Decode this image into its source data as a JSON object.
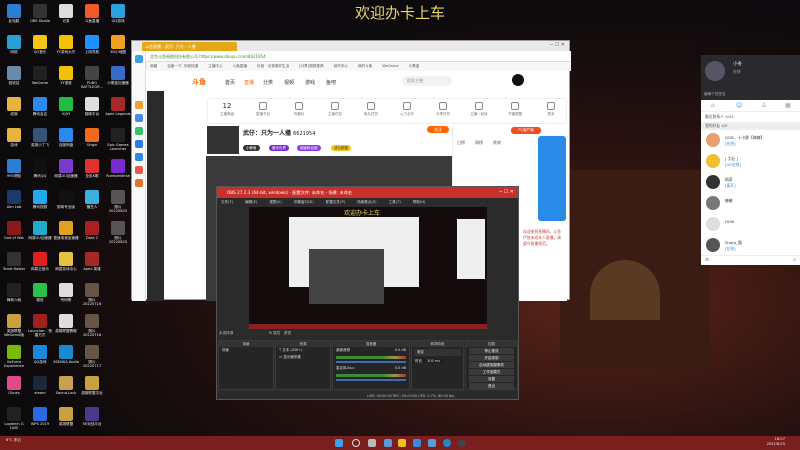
{
  "desktop": {
    "banner": "欢迎办卡上车",
    "icons": [
      [
        "此电脑",
        "#2a7fd4"
      ],
      [
        "OBS Studio",
        "#333"
      ],
      [
        "记录",
        "#ddd"
      ],
      [
        "斗鱼直播",
        "#f05a28"
      ],
      [
        "QQ游戏",
        "#29a3e0"
      ],
      [
        "网络",
        "#2a9fd4"
      ],
      [
        "QQ音乐",
        "#f5c518"
      ],
      [
        "YY游戏大厅",
        "#f2c200"
      ],
      [
        "上网导航",
        "#1e90ff"
      ],
      [
        "3D小地图",
        "#f0a020"
      ],
      [
        "回收站",
        "#6a8aa8"
      ],
      [
        "WeGame",
        "#222"
      ],
      [
        "YY语音",
        "#f2c200"
      ],
      [
        "PUBG BATTLEGR...",
        "#444"
      ],
      [
        "小黑盒加速器",
        "#3a6ac8"
      ],
      [
        "成就",
        "#e8b440"
      ],
      [
        "腾讯会议",
        "#2a8af0"
      ],
      [
        "iQIYI",
        "#22bb44"
      ],
      [
        "猫咪平台",
        "#ddd"
      ],
      [
        "Apex Legends",
        "#a82828"
      ],
      [
        "游戏",
        "#e8b440"
      ],
      [
        "英雄小丁飞",
        "#335577"
      ],
      [
        "百度网盘",
        "#2a88ee"
      ],
      [
        "Origin",
        "#f06a1a"
      ],
      [
        "Epic Games Launcher",
        "#222"
      ],
      [
        "990测验",
        "#2a7fd4"
      ],
      [
        "腾讯QQ",
        "#111"
      ],
      [
        "网易UU加速器",
        "#7a3ad0"
      ],
      [
        "全民K歌",
        "#e03030"
      ],
      [
        "RumbleVerse",
        "#7a2ad0"
      ],
      [
        "Aim Lab",
        "#1a3a6a"
      ],
      [
        "腾讯视频",
        "#22aaee"
      ],
      [
        "剪映专业版",
        "#111"
      ],
      [
        "糖豆人",
        "#3ab0e0"
      ],
      [
        "照片 20220825",
        "#555"
      ],
      [
        "God of War",
        "#8a1a1a"
      ],
      [
        "网易UU加速器",
        "#22aacc"
      ],
      [
        "极速电竞加速器",
        "#e0a020"
      ],
      [
        "Dota 2",
        "#a82020"
      ],
      [
        "照片 20220825",
        "#555"
      ],
      [
        "Tomb Raider",
        "#333"
      ],
      [
        "网易云音乐",
        "#e02020"
      ],
      [
        "网易游戏中心",
        "#e8c040"
      ],
      [
        "Apex 英雄",
        "#a82828"
      ],
      [
        "梅林六耗",
        "#222"
      ],
      [
        "微信",
        "#2ac04a"
      ],
      [
        "号码等",
        "#ddd"
      ],
      [
        "照片 20220716",
        "#665544"
      ],
      [
        "英雄联盟WeGame版",
        "#c8a040"
      ],
      [
        "Launcher - 快捷方式",
        "#a02020"
      ],
      [
        "英雄联盟教程",
        "#ddd"
      ],
      [
        "照片 20220716",
        "#665544"
      ],
      [
        "GeForce Experience",
        "#76b900"
      ],
      [
        "QQ游戏",
        "#1a8ae0"
      ],
      [
        "XSENSA Audio",
        "#1a8ad0"
      ],
      [
        "照片 20220717",
        "#665544"
      ],
      [
        "iTunes",
        "#e04a8a"
      ],
      [
        "steam",
        "#1b2838"
      ],
      [
        "Sound Lock",
        "#c8a050"
      ],
      [
        "英雄联盟平台",
        "#c8a040"
      ],
      [
        "Logitech G HUB",
        "#222"
      ],
      [
        "WPS 2019",
        "#2a6ae0"
      ],
      [
        "英雄联盟",
        "#c8a040"
      ],
      [
        "5E对战平台",
        "#4a3a8a"
      ]
    ]
  },
  "browser": {
    "tab": "斗鱼直播 - 武仔: 只为一人播",
    "address": "北京斗鱼网络科技有限公司 https://www.douyu.com/6621954",
    "bookmarks": [
      "收藏",
      "百度一下, 你就知道",
      "主播中心",
      "斗鱼直播",
      "抖音 · 记录美好生活",
      "[分享]视频推荐",
      "创作中心",
      "我的斗鱼",
      "WeGame",
      "小黑盒"
    ],
    "nav": [
      "首页",
      "直播",
      "分类",
      "视频",
      "游戏",
      "鱼吧"
    ],
    "logo": "斗鱼",
    "search_placeholder": "搜索主播",
    "icons_row": [
      {
        "label": "主播等级",
        "value": "12"
      },
      {
        "label": "直播节目"
      },
      {
        "label": "有趣玩"
      },
      {
        "label": "主播任务"
      },
      {
        "label": "鱼丸任务"
      },
      {
        "label": "火力全开"
      },
      {
        "label": "分享任务"
      },
      {
        "label": "主播一起玩"
      },
      {
        "label": "开播提醒"
      },
      {
        "label": "更多"
      }
    ],
    "streamer_title": "武仔：只为一人播",
    "room_id": "6621954",
    "chips": [
      "小鲸鱼",
      "魔法世界",
      "超级粉丝团",
      "成为超管"
    ],
    "follow": "关注",
    "pc_client": "PC客户端",
    "right_tabs": [
      "日榜",
      "周榜",
      "贵宾"
    ],
    "right_notice": "欢迎来到直播间，斗鱼严禁未成年人直播，请遵守直播规范。"
  },
  "obs": {
    "title": "OBS 27.2.3 (64-bit, windows) - 配置文件: 未命名 - 场景: 未命名",
    "menu": [
      "文件(F)",
      "编辑(E)",
      "视图(V)",
      "停靠窗口(D)",
      "配置文件(P)",
      "场景集合(S)",
      "工具(T)",
      "帮助(H)"
    ],
    "docks": {
      "scenes": "场景",
      "sources": "来源",
      "mixer": "混音器",
      "transitions": "转场特效",
      "controls": "控制"
    },
    "scene_items": [
      "场景"
    ],
    "source_items": [
      "文本 (GDI+)",
      "显示器采集"
    ],
    "mixer": [
      {
        "name": "桌面音频",
        "db": "0.0 dB"
      },
      {
        "name": "麦克风/Aux",
        "db": "0.0 dB"
      }
    ],
    "transition": "渐变",
    "duration_label": "时长",
    "duration": "300 ms",
    "controls": [
      "停止推流",
      "开始录制",
      "启动虚拟摄像机",
      "工作室模式",
      "设置",
      "退出"
    ],
    "status": "LIVE: 00:00:00   REC: 00:00:00   CPU: 0.7%, 60.00 fps",
    "no_source": "未选择源",
    "props": "属性",
    "filters": "滤镜"
  },
  "qq": {
    "name": "小冬",
    "status": "在线",
    "sign": "编辑个性签名",
    "groups": [
      "最近联系人 3/24",
      "我的好友 4/5"
    ],
    "contacts": [
      {
        "name": "GOD - 十小胖【梅梅】",
        "msg": "[在线]"
      },
      {
        "name": "[ 大壮 ]",
        "msg": "[4G在线]"
      },
      {
        "name": "佩奇",
        "msg": "[离开]"
      },
      {
        "name": "椿椿",
        "msg": ""
      },
      {
        "name": "HUXI",
        "msg": ""
      },
      {
        "name": "Sharp_猫",
        "msg": "[在线]"
      }
    ]
  },
  "taskbar": {
    "weather": "6°C 多云",
    "time": "18:07",
    "date": "2022/8/25"
  }
}
